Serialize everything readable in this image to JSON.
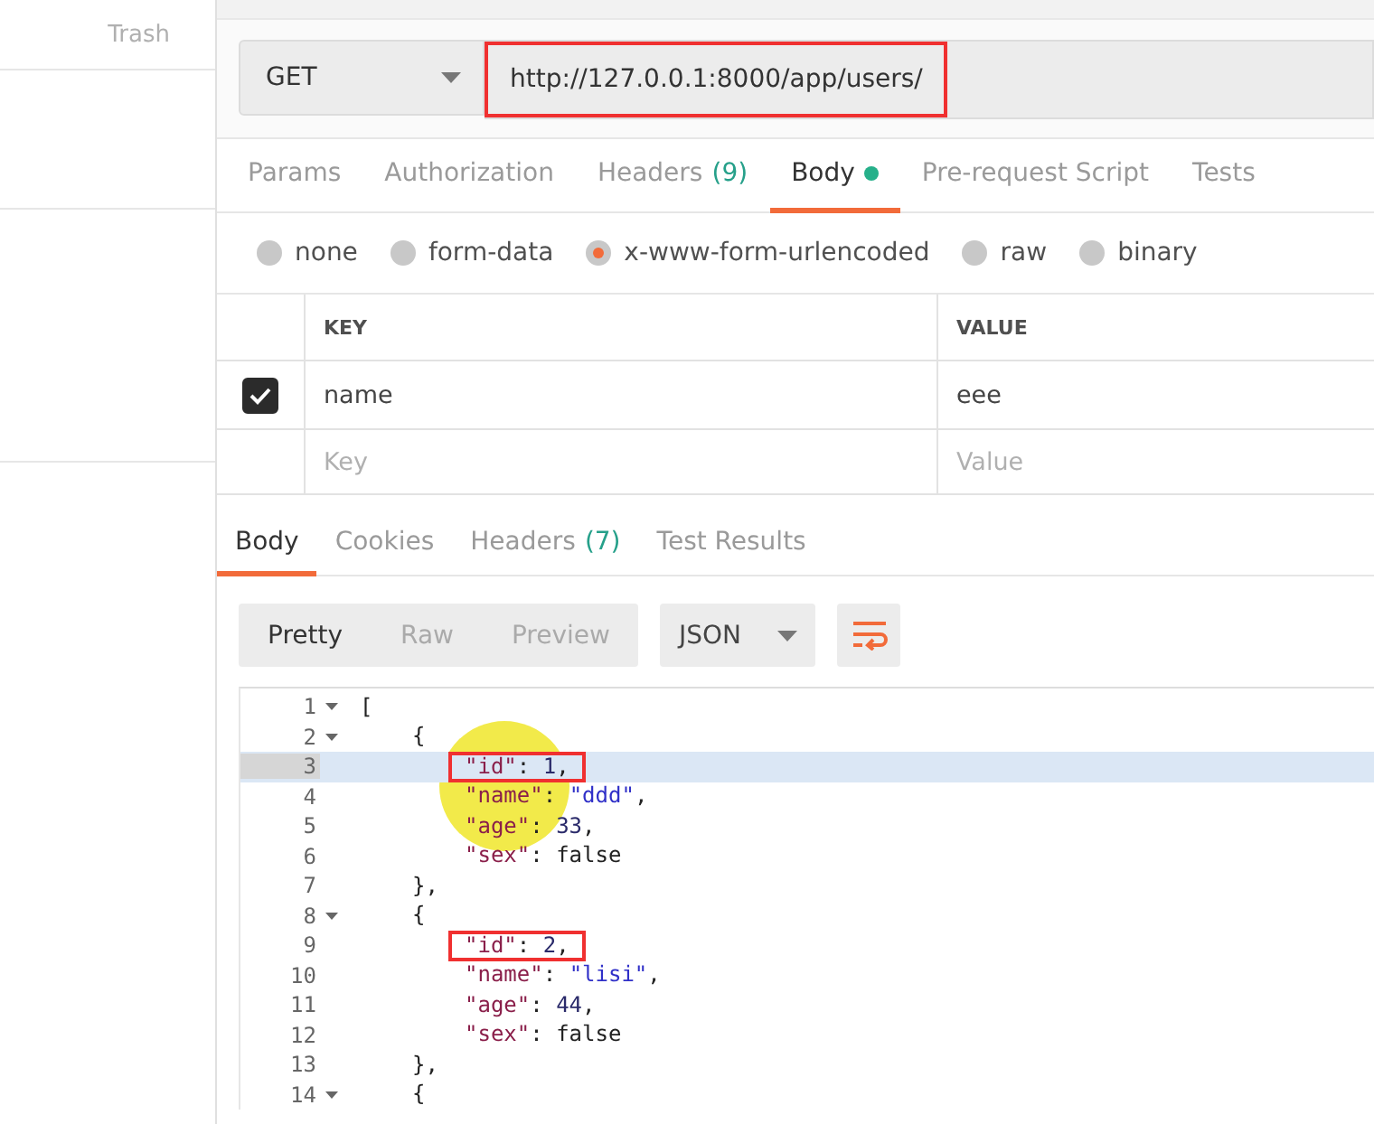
{
  "sidebar": {
    "trash_label": "Trash"
  },
  "request": {
    "method": "GET",
    "url": "http://127.0.0.1:8000/app/users/",
    "url_boxed": true
  },
  "request_tabs": [
    {
      "label": "Params",
      "selected": false,
      "dot": false
    },
    {
      "label": "Authorization",
      "selected": false,
      "dot": false
    },
    {
      "label": "Headers",
      "count": "(9)",
      "selected": false,
      "dot": false
    },
    {
      "label": "Body",
      "dot": true,
      "selected": true
    },
    {
      "label": "Pre-request Script",
      "selected": false,
      "dot": false
    },
    {
      "label": "Tests",
      "selected": false,
      "dot": false
    }
  ],
  "body_types": [
    {
      "label": "none",
      "selected": false
    },
    {
      "label": "form-data",
      "selected": false
    },
    {
      "label": "x-www-form-urlencoded",
      "selected": true
    },
    {
      "label": "raw",
      "selected": false
    },
    {
      "label": "binary",
      "selected": false
    }
  ],
  "params_table": {
    "columns": [
      "KEY",
      "VALUE"
    ],
    "rows": [
      {
        "checked": true,
        "key": "name",
        "value": "eee"
      }
    ],
    "new_row": {
      "key_placeholder": "Key",
      "value_placeholder": "Value"
    }
  },
  "response_tabs": [
    {
      "label": "Body",
      "selected": true
    },
    {
      "label": "Cookies",
      "selected": false
    },
    {
      "label": "Headers",
      "count": "(7)",
      "selected": false
    },
    {
      "label": "Test Results",
      "selected": false
    }
  ],
  "view_modes": [
    {
      "label": "Pretty",
      "selected": true
    },
    {
      "label": "Raw",
      "selected": false
    },
    {
      "label": "Preview",
      "selected": false
    }
  ],
  "format": "JSON",
  "code_lines": [
    {
      "num": "1",
      "kind": "root",
      "fold": true,
      "active": false,
      "boxed": false,
      "tokens": [
        {
          "kind": "punct",
          "text": "["
        }
      ]
    },
    {
      "num": "2",
      "kind": "brace",
      "fold": true,
      "active": false,
      "boxed": false,
      "tokens": [
        {
          "kind": "punct",
          "text": "{"
        }
      ]
    },
    {
      "num": "3",
      "kind": "member",
      "fold": false,
      "active": true,
      "boxed": true,
      "tokens": [
        {
          "kind": "key",
          "text": "\"id\""
        },
        {
          "kind": "punct",
          "text": ": "
        },
        {
          "kind": "number",
          "text": "1"
        },
        {
          "kind": "punct",
          "text": ","
        }
      ]
    },
    {
      "num": "4",
      "kind": "member",
      "fold": false,
      "active": false,
      "boxed": false,
      "tokens": [
        {
          "kind": "key",
          "text": "\"name\""
        },
        {
          "kind": "punct",
          "text": ": "
        },
        {
          "kind": "string",
          "text": "\"ddd\""
        },
        {
          "kind": "punct",
          "text": ","
        }
      ]
    },
    {
      "num": "5",
      "kind": "member",
      "fold": false,
      "active": false,
      "boxed": false,
      "tokens": [
        {
          "kind": "key",
          "text": "\"age\""
        },
        {
          "kind": "punct",
          "text": ": "
        },
        {
          "kind": "number",
          "text": "33"
        },
        {
          "kind": "punct",
          "text": ","
        }
      ]
    },
    {
      "num": "6",
      "kind": "member",
      "fold": false,
      "active": false,
      "boxed": false,
      "tokens": [
        {
          "kind": "key",
          "text": "\"sex\""
        },
        {
          "kind": "punct",
          "text": ": "
        },
        {
          "kind": "bool",
          "text": "false"
        }
      ]
    },
    {
      "num": "7",
      "kind": "brace",
      "fold": false,
      "active": false,
      "boxed": false,
      "tokens": [
        {
          "kind": "punct",
          "text": "},"
        }
      ]
    },
    {
      "num": "8",
      "kind": "brace",
      "fold": true,
      "active": false,
      "boxed": false,
      "tokens": [
        {
          "kind": "punct",
          "text": "{"
        }
      ]
    },
    {
      "num": "9",
      "kind": "member",
      "fold": false,
      "active": false,
      "boxed": true,
      "tokens": [
        {
          "kind": "key",
          "text": "\"id\""
        },
        {
          "kind": "punct",
          "text": ": "
        },
        {
          "kind": "number",
          "text": "2"
        },
        {
          "kind": "punct",
          "text": ","
        }
      ]
    },
    {
      "num": "10",
      "kind": "member",
      "fold": false,
      "active": false,
      "boxed": false,
      "tokens": [
        {
          "kind": "key",
          "text": "\"name\""
        },
        {
          "kind": "punct",
          "text": ": "
        },
        {
          "kind": "string",
          "text": "\"lisi\""
        },
        {
          "kind": "punct",
          "text": ","
        }
      ]
    },
    {
      "num": "11",
      "kind": "member",
      "fold": false,
      "active": false,
      "boxed": false,
      "tokens": [
        {
          "kind": "key",
          "text": "\"age\""
        },
        {
          "kind": "punct",
          "text": ": "
        },
        {
          "kind": "number",
          "text": "44"
        },
        {
          "kind": "punct",
          "text": ","
        }
      ]
    },
    {
      "num": "12",
      "kind": "member",
      "fold": false,
      "active": false,
      "boxed": false,
      "tokens": [
        {
          "kind": "key",
          "text": "\"sex\""
        },
        {
          "kind": "punct",
          "text": ": "
        },
        {
          "kind": "bool",
          "text": "false"
        }
      ]
    },
    {
      "num": "13",
      "kind": "brace",
      "fold": false,
      "active": false,
      "boxed": false,
      "tokens": [
        {
          "kind": "punct",
          "text": "},"
        }
      ]
    },
    {
      "num": "14",
      "kind": "brace",
      "fold": true,
      "active": false,
      "boxed": false,
      "tokens": [
        {
          "kind": "punct",
          "text": "{"
        }
      ]
    }
  ]
}
